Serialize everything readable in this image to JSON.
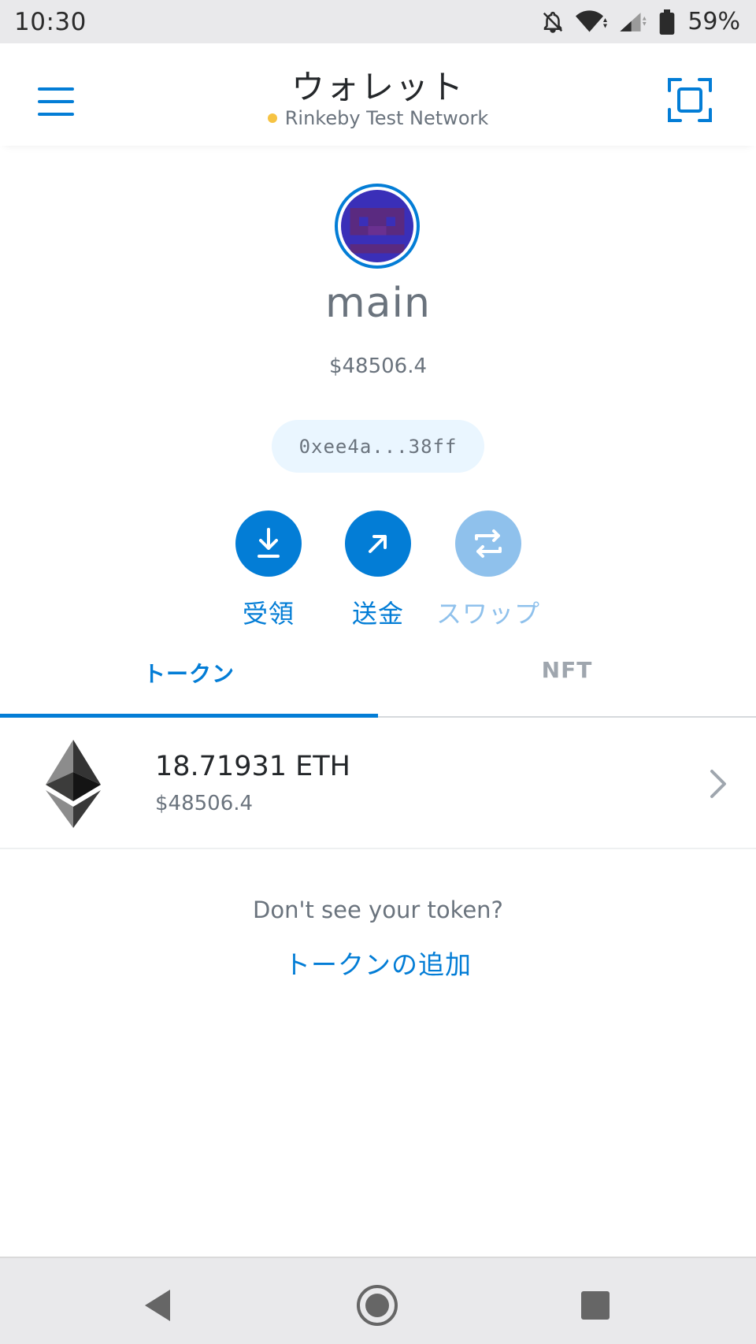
{
  "status_bar": {
    "time": "10:30",
    "battery": "59%",
    "icons": [
      "bell-off-icon",
      "wifi-icon",
      "cell-signal-icon",
      "battery-icon"
    ]
  },
  "header": {
    "title": "ウォレット",
    "network": "Rinkeby Test Network",
    "network_dot_color": "#f6c343",
    "menu_icon": "hamburger-menu-icon",
    "scan_icon": "qr-scan-icon"
  },
  "account": {
    "name": "main",
    "balance": "$48506.4",
    "address": "0xee4a...38ff"
  },
  "actions": [
    {
      "label": "受領",
      "icon": "download-arrow-icon",
      "enabled": true
    },
    {
      "label": "送金",
      "icon": "send-arrow-icon",
      "enabled": true
    },
    {
      "label": "スワップ",
      "icon": "swap-icon",
      "enabled": false
    }
  ],
  "tabs": [
    {
      "label": "トークン",
      "active": true
    },
    {
      "label": "NFT",
      "active": false
    }
  ],
  "tokens": [
    {
      "amount": "18.71931 ETH",
      "fiat": "$48506.4",
      "icon": "ethereum-icon"
    }
  ],
  "empty_hint": {
    "text": "Don't see your token?",
    "link": "トークンの追加"
  },
  "colors": {
    "accent": "#037dd6",
    "accent_disabled": "#8fc1ec",
    "address_bg": "#eaf6ff",
    "text_muted": "#6a737d"
  }
}
